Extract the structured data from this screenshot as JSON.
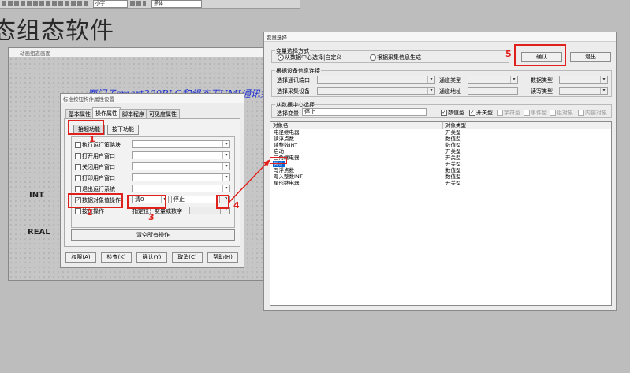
{
  "top_toolbar": {
    "combo_a": "小字",
    "combo_b": "黑体"
  },
  "bg_heading": "态组态软件",
  "canvas_title": "动画组态画面",
  "canvas_text": "西门子smart200PLC和组态王HMI通讯案例",
  "side_labels": [
    "INT",
    "REAL"
  ],
  "prop_dialog": {
    "title": "标准按钮构件属性设置",
    "tabs": [
      "基本属性",
      "操作属性",
      "脚本程序",
      "可见度属性"
    ],
    "subtabs": [
      "抬起功能",
      "按下功能"
    ],
    "actions": [
      {
        "label": "执行运行策略块",
        "checked": false
      },
      {
        "label": "打开用户窗口",
        "checked": false
      },
      {
        "label": "关闭用户窗口",
        "checked": false
      },
      {
        "label": "打印用户窗口",
        "checked": false
      },
      {
        "label": "退出运行系统",
        "checked": false
      }
    ],
    "data_op": {
      "label": "数据对象值操作",
      "checked": true,
      "op": "清0",
      "var": "停止",
      "pick": "?"
    },
    "bit_op": {
      "label": "按位操作",
      "checked": false,
      "hint": "指定位：变量或数字",
      "pick": "?"
    },
    "clear_all": "清空所有操作",
    "buttons": [
      "权限(A)",
      "检查(K)",
      "确认(Y)",
      "取消(C)",
      "帮助(H)"
    ]
  },
  "var_dialog": {
    "title": "变量选择",
    "mode_group": "变量选择方式",
    "mode_opt1": "从数据中心选择|自定义",
    "mode_opt2": "根据采集信息生成",
    "confirm": "确认",
    "exit": "退出",
    "dev_group": "根据设备信息连接",
    "dev_labels": [
      "选择通讯端口",
      "通道类型",
      "数据类型",
      "选择采集设备",
      "通道地址",
      "读写类型"
    ],
    "center_group": "从数据中心选择",
    "select_var_label": "选择变量",
    "select_var_value": "停止",
    "filters": [
      {
        "label": "数值型",
        "checked": true,
        "enabled": true
      },
      {
        "label": "开关型",
        "checked": true,
        "enabled": true
      },
      {
        "label": "字符型",
        "checked": false,
        "enabled": false
      },
      {
        "label": "事件型",
        "checked": false,
        "enabled": false
      },
      {
        "label": "组对象",
        "checked": false,
        "enabled": false
      },
      {
        "label": "内部对象",
        "checked": false,
        "enabled": false
      }
    ],
    "col_name": "对象名",
    "col_type": "对象类型",
    "rows": [
      {
        "name": "电径继电器",
        "type": "开关型",
        "selected": false
      },
      {
        "name": "读浮点数",
        "type": "数值型",
        "selected": false
      },
      {
        "name": "读整数INT",
        "type": "数值型",
        "selected": false
      },
      {
        "name": "启动",
        "type": "开关型",
        "selected": false
      },
      {
        "name": "三角继电器",
        "type": "开关型",
        "selected": false
      },
      {
        "name": "停止",
        "type": "开关型",
        "selected": true
      },
      {
        "name": "写浮点数",
        "type": "数值型",
        "selected": false
      },
      {
        "name": "写入整数INT",
        "type": "数值型",
        "selected": false
      },
      {
        "name": "星形继电器",
        "type": "开关型",
        "selected": false
      }
    ]
  },
  "annotations": [
    "1",
    "2",
    "3",
    "4",
    "5"
  ],
  "colors": {
    "highlight": "#e0201c",
    "selection": "#0a64d6"
  }
}
